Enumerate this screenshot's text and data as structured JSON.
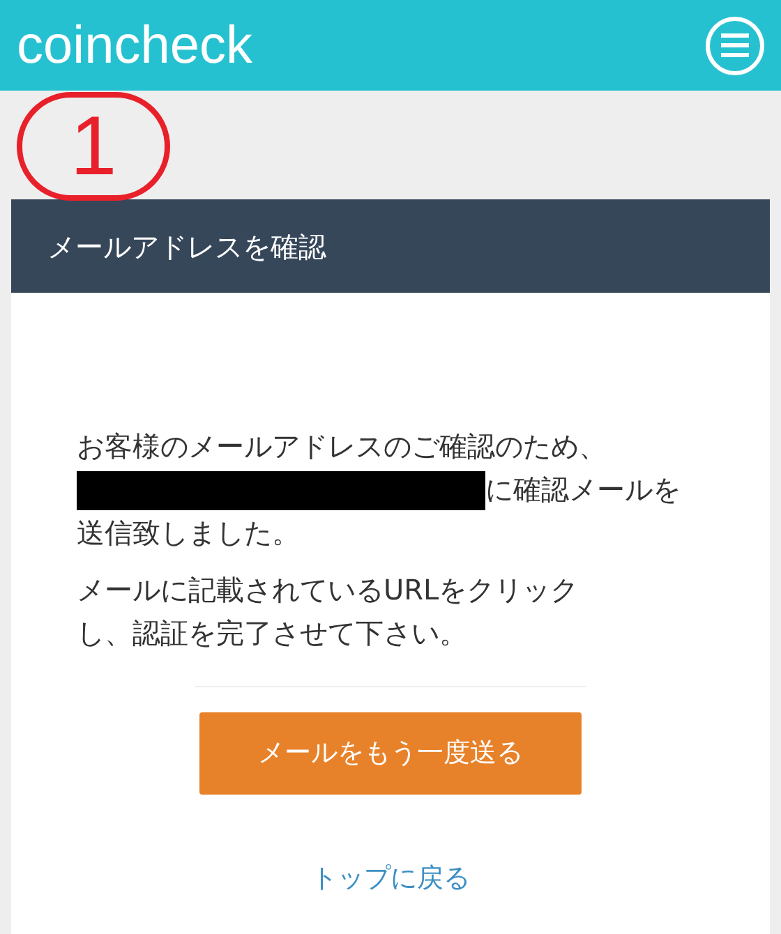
{
  "header": {
    "logo": "coincheck"
  },
  "annotation": {
    "label": "1"
  },
  "section_title": "メールアドレスを確認",
  "message": {
    "line_1": "お客様のメールアドレスのご確認のため、",
    "redacted": true,
    "line_2_rest": "に確認メールを",
    "line_3": "送信致しました。"
  },
  "instructions": [
    "メールに記載されているURLをクリック",
    "し、認証を完了させて下さい。"
  ],
  "resend_button": "メールをもう一度送る",
  "back_link": "トップに戻る"
}
